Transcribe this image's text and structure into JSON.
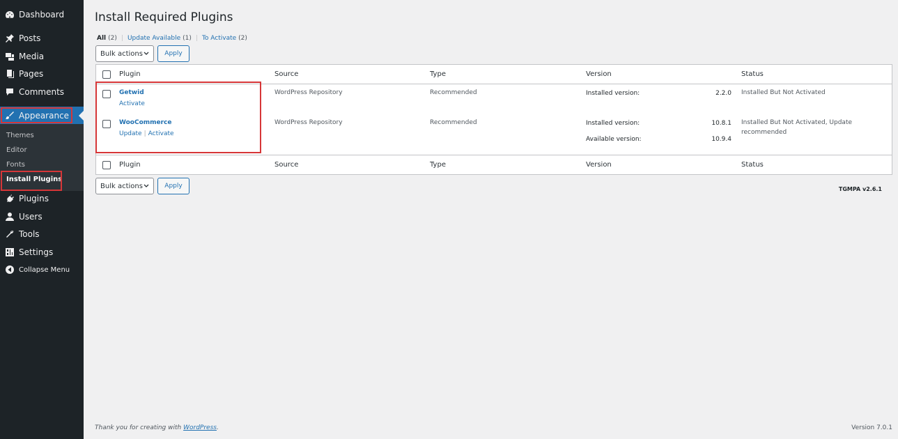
{
  "sidebar": {
    "items": [
      {
        "label": "Dashboard",
        "icon": "dashboard-icon"
      },
      {
        "label": "Posts",
        "icon": "pushpin-icon"
      },
      {
        "label": "Media",
        "icon": "media-icon"
      },
      {
        "label": "Pages",
        "icon": "pages-icon"
      },
      {
        "label": "Comments",
        "icon": "comment-icon"
      },
      {
        "label": "Appearance",
        "icon": "paintbrush-icon"
      },
      {
        "label": "Plugins",
        "icon": "plugin-icon"
      },
      {
        "label": "Users",
        "icon": "user-icon"
      },
      {
        "label": "Tools",
        "icon": "wrench-icon"
      },
      {
        "label": "Settings",
        "icon": "settings-icon"
      },
      {
        "label": "Collapse Menu",
        "icon": "collapse-icon"
      }
    ],
    "submenu": [
      "Themes",
      "Editor",
      "Fonts",
      "Install Plugins"
    ]
  },
  "page": {
    "title": "Install Required Plugins",
    "filters": [
      {
        "label": "All",
        "count": "(2)"
      },
      {
        "label": "Update Available",
        "count": "(1)"
      },
      {
        "label": "To Activate",
        "count": "(2)"
      }
    ],
    "filter_separator": "|"
  },
  "bulk": {
    "label": "Bulk actions",
    "apply": "Apply"
  },
  "table": {
    "columns": [
      "Plugin",
      "Source",
      "Type",
      "Version",
      "Status"
    ],
    "rows": [
      {
        "name": "Getwid",
        "actions": [
          "Activate"
        ],
        "source": "WordPress Repository",
        "type": "Recommended",
        "installed_label": "Installed version:",
        "installed": "2.2.0",
        "status": "Installed But Not Activated"
      },
      {
        "name": "WooCommerce",
        "actions": [
          "Update",
          "Activate"
        ],
        "action_separator": "|",
        "source": "WordPress Repository",
        "type": "Recommended",
        "installed_label": "Installed version:",
        "installed": "10.8.1",
        "available_label": "Available version:",
        "available": "10.9.4",
        "status": "Installed But Not Activated, Update recommended"
      }
    ]
  },
  "tgmpa_version": "TGMPA v2.6.1",
  "footer": {
    "thanks_prefix": "Thank you for creating with",
    "thanks_link": "WordPress",
    "thanks_suffix": ".",
    "version": "Version 7.0.1"
  },
  "colors": {
    "sidebar_bg": "#1d2327",
    "active_menu": "#2271b1",
    "highlight_box": "#d63638",
    "link": "#2271b1"
  }
}
